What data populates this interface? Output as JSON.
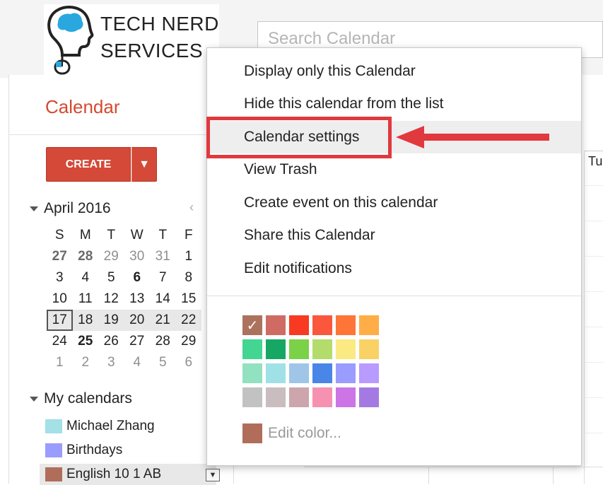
{
  "logo": {
    "line1": "TECH NERD",
    "line2": "SERVICES",
    "icon": "brain-head-mouse-logo"
  },
  "search": {
    "placeholder": "Search Calendar"
  },
  "app": {
    "title": "Calendar"
  },
  "create": {
    "label": "CREATE",
    "dropdown_glyph": "▼"
  },
  "mini_calendar": {
    "month": "April 2016",
    "prev_glyph": "‹",
    "weekdays": [
      "S",
      "M",
      "T",
      "W",
      "T",
      "F"
    ],
    "weeks": [
      [
        "27",
        "28",
        "29",
        "30",
        "31",
        "1"
      ],
      [
        "3",
        "4",
        "5",
        "6",
        "7",
        "8"
      ],
      [
        "10",
        "11",
        "12",
        "13",
        "14",
        "15"
      ],
      [
        "17",
        "18",
        "19",
        "20",
        "21",
        "22"
      ],
      [
        "24",
        "25",
        "26",
        "27",
        "28",
        "29"
      ],
      [
        "1",
        "2",
        "3",
        "4",
        "5",
        "6"
      ]
    ]
  },
  "my_calendars": {
    "header": "My calendars",
    "items": [
      {
        "label": "Michael Zhang",
        "color": "#a3e1e6"
      },
      {
        "label": "Birthdays",
        "color": "#9a9cff"
      },
      {
        "label": "English 10 1 AB",
        "color": "#b06e5a"
      }
    ],
    "dropdown_glyph": "▼"
  },
  "grid": {
    "day_label": "Tu"
  },
  "menu": {
    "items": [
      "Display only this Calendar",
      "Hide this calendar from the list",
      "Calendar settings",
      "View Trash",
      "Create event on this calendar",
      "Share this Calendar",
      "Edit notifications"
    ],
    "highlighted_index": 2,
    "palette": [
      [
        "#ac725e",
        "#d06b64",
        "#f83a22",
        "#fa573c",
        "#ff7537",
        "#ffad46"
      ],
      [
        "#42d692",
        "#16a765",
        "#7bd148",
        "#b3dc6c",
        "#fbe983",
        "#fad165"
      ],
      [
        "#92e1c0",
        "#9fe1e7",
        "#9fc6e7",
        "#4986e7",
        "#9a9cff",
        "#b99aff"
      ],
      [
        "#c2c2c2",
        "#cabdbf",
        "#cca6ac",
        "#f691b2",
        "#cd74e6",
        "#a47ae2"
      ]
    ],
    "selected_color": "#ac725e",
    "edit_color_label": "Edit color...",
    "edit_color_swatch": "#b06e5a"
  },
  "annotation": {
    "box_color": "#e0393e",
    "arrow_color": "#e0393e"
  }
}
